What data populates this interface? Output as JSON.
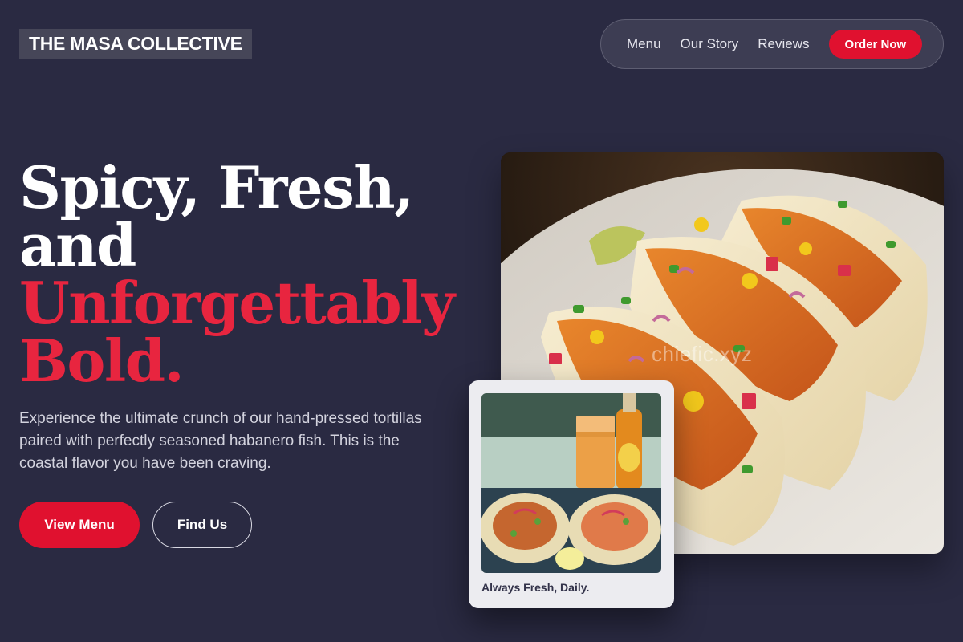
{
  "brand": {
    "name": "THE MASA COLLECTIVE"
  },
  "nav": {
    "links": [
      "Menu",
      "Our Story",
      "Reviews"
    ],
    "cta_label": "Order Now"
  },
  "hero": {
    "headline_lines": [
      "Spicy, Fresh,",
      "and"
    ],
    "headline_accent_lines": [
      "Unforgettably",
      "Bold."
    ],
    "subcopy": "Experience the ultimate crunch of our hand-pressed tortillas paired with perfectly seasoned habanero fish. This is the coastal flavor you have been craving.",
    "primary_button": "View Menu",
    "secondary_button": "Find Us",
    "image_watermark": "chiefic.xyz"
  },
  "card": {
    "caption": "Always Fresh, Daily."
  },
  "colors": {
    "background": "#2a2a42",
    "accent": "#e0112f",
    "accent_text": "#e8253f"
  }
}
